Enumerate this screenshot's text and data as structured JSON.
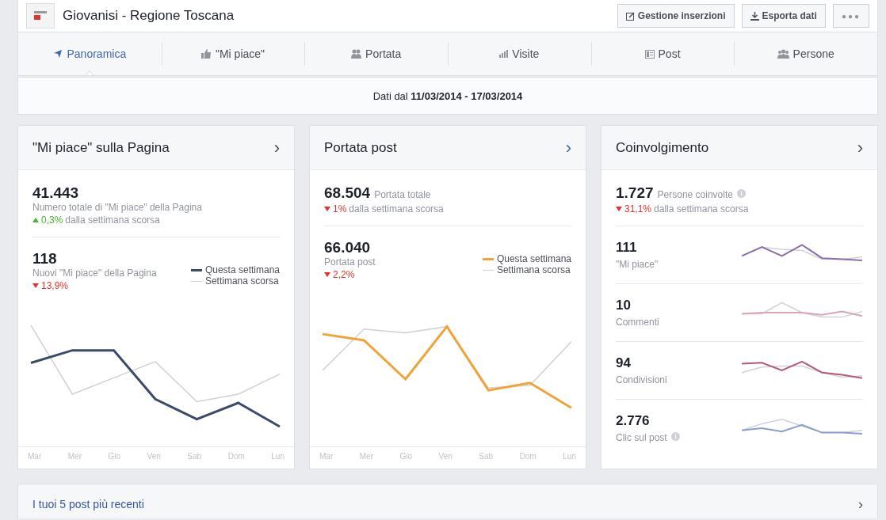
{
  "header": {
    "title": "Giovanisi - Regione Toscana",
    "buttons": [
      {
        "kind": "manage",
        "label": "Gestione inserzioni"
      },
      {
        "kind": "export",
        "label": "Esporta dati"
      },
      {
        "kind": "more",
        "label": "●●●"
      }
    ]
  },
  "tabs": [
    {
      "label": "Panoramica",
      "selected": true
    },
    {
      "label": "\"Mi piace\"",
      "selected": false
    },
    {
      "label": "Portata",
      "selected": false
    },
    {
      "label": "Visite",
      "selected": false
    },
    {
      "label": "Post",
      "selected": false
    },
    {
      "label": "Persone",
      "selected": false
    }
  ],
  "date_bar": {
    "prefix": "Dati dal ",
    "range": "11/03/2014 - 17/03/2014"
  },
  "cards": [
    {
      "kind": "chart",
      "title": "\"Mi piace\" sulla Pagina",
      "chevron": "›",
      "chevron_active": false,
      "summary": {
        "value": "41.443",
        "label": "Numero totale di \"Mi piace\" della Pagina",
        "rising": true,
        "change": "0,3%",
        "change_text": "dalla settimana scorsa"
      },
      "detail": {
        "value": "118",
        "label": "Nuovi \"Mi piace\" della Pagina",
        "rising": false,
        "change": "13,9%"
      },
      "legend": [
        {
          "label": "Questa settimana",
          "color": "#3b4a6b"
        },
        {
          "label": "Settimana scorsa",
          "color": "#d0d1d5"
        }
      ],
      "x_labels": [
        "Mar",
        "Mer",
        "Gio",
        "Ven",
        "Sab",
        "Dom",
        "Lun"
      ]
    },
    {
      "kind": "chart",
      "title": "Portata post",
      "chevron": "›",
      "chevron_active": true,
      "summary": {
        "value": "68.504",
        "label": "Portata totale",
        "rising": false,
        "change": "1%",
        "change_text": "dalla settimana scorsa"
      },
      "detail": {
        "value": "66.040",
        "label": "Portata post",
        "rising": false,
        "change": "2,2%"
      },
      "legend": [
        {
          "label": "Questa settimana",
          "color": "#f0a338"
        },
        {
          "label": "Settimana scorsa",
          "color": "#d0d1d5"
        }
      ],
      "x_labels": [
        "Mar",
        "Mer",
        "Gio",
        "Ven",
        "Sab",
        "Dom",
        "Lun"
      ]
    },
    {
      "kind": "metrics",
      "title": "Coinvolgimento",
      "chevron": "›",
      "chevron_active": false,
      "summary": {
        "value": "1.727",
        "label": "Persone coinvolte",
        "info": true,
        "rising": false,
        "change": "31,1%",
        "change_text": "dalla settimana scorsa"
      },
      "metrics": [
        {
          "value": "111",
          "label": "\"Mi piace\"",
          "info": false,
          "color": "#8b6fa8"
        },
        {
          "value": "10",
          "label": "Commenti",
          "info": false,
          "color": "#d9a6b8"
        },
        {
          "value": "94",
          "label": "Condivisioni",
          "info": false,
          "color": "#b55a78"
        },
        {
          "value": "2.776",
          "label": "Clic sul post",
          "info": true,
          "color": "#8a9ed0"
        }
      ]
    }
  ],
  "recent_posts": {
    "title": "I tuoi 5 post più recenti",
    "chevron": "›"
  }
}
